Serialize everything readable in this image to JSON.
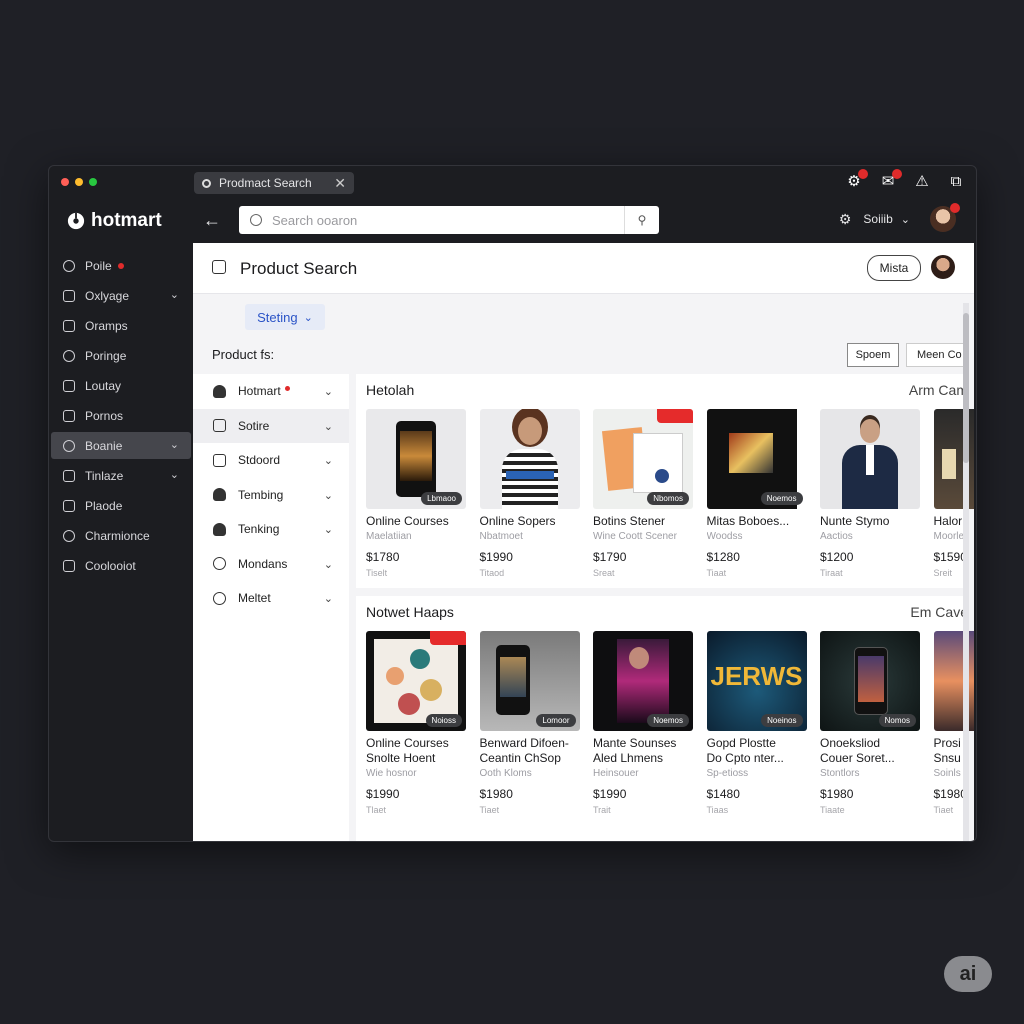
{
  "tab": {
    "title": "Prodmact Search",
    "close": "✕"
  },
  "sidebar": {
    "logo": "hotmart",
    "items": [
      {
        "label": "Poile",
        "has_dot": true,
        "has_chevron": false,
        "active": false
      },
      {
        "label": "Oxlyage",
        "has_dot": false,
        "has_chevron": true,
        "active": false
      },
      {
        "label": "Oramps",
        "has_dot": false,
        "has_chevron": false,
        "active": false
      },
      {
        "label": "Poringe",
        "has_dot": false,
        "has_chevron": false,
        "active": false
      },
      {
        "label": "Loutay",
        "has_dot": false,
        "has_chevron": false,
        "active": false
      },
      {
        "label": "Pornos",
        "has_dot": false,
        "has_chevron": false,
        "active": false
      },
      {
        "label": "Boanie",
        "has_dot": false,
        "has_chevron": true,
        "active": true
      },
      {
        "label": "Tinlaze",
        "has_dot": false,
        "has_chevron": true,
        "active": false
      },
      {
        "label": "Plaode",
        "has_dot": false,
        "has_chevron": false,
        "active": false
      },
      {
        "label": "Charmionce",
        "has_dot": false,
        "has_chevron": false,
        "active": false
      },
      {
        "label": "Coolooiot",
        "has_dot": false,
        "has_chevron": false,
        "active": false
      }
    ]
  },
  "topbar": {
    "search_placeholder": "Search ooaron",
    "account_label": "Soiiib"
  },
  "header": {
    "title": "Product Search",
    "button": "Mista"
  },
  "toolbar": {
    "sort_label": "Steting",
    "sort_chevron": "⌄",
    "filter_label": "Product fs:",
    "btn_primary": "Spoem",
    "btn_secondary": "Meen Co"
  },
  "filters": [
    {
      "label": "Hotmart",
      "dot": true,
      "active": false,
      "icon": "people-icon"
    },
    {
      "label": "Sotire",
      "dot": false,
      "active": true,
      "icon": "square-icon"
    },
    {
      "label": "Stdoord",
      "dot": false,
      "active": false,
      "icon": "frame-icon"
    },
    {
      "label": "Tembing",
      "dot": false,
      "active": false,
      "icon": "cloud-icon"
    },
    {
      "label": "Tenking",
      "dot": false,
      "active": false,
      "icon": "people-icon"
    },
    {
      "label": "Mondans",
      "dot": false,
      "active": false,
      "icon": "bell-icon"
    },
    {
      "label": "Meltet",
      "dot": false,
      "active": false,
      "icon": "location-icon"
    }
  ],
  "sections": [
    {
      "title": "Hetolah",
      "right": "Arm Cam",
      "cards": [
        {
          "title": "Online Courses",
          "sub": "Maelatiian",
          "price": "$1780",
          "meta": "Tiselt",
          "tag": "Lbmaoo",
          "hot": false,
          "art": "phone"
        },
        {
          "title": "Online Sopers",
          "sub": "Nbatmoet",
          "price": "$1990",
          "meta": "Titaod",
          "tag": "",
          "hot": false,
          "art": "woman"
        },
        {
          "title": "Botins Stener",
          "sub": "Wine Coott Scener",
          "price": "$1790",
          "meta": "Sreat",
          "tag": "Nbomos",
          "hot": true,
          "art": "book"
        },
        {
          "title": "Mitas Boboes...",
          "sub": "Woodss",
          "price": "$1280",
          "meta": "Tiaat",
          "tag": "Noemos",
          "hot": false,
          "art": "dark"
        },
        {
          "title": "Nunte Stymo",
          "sub": "Aactios",
          "price": "$1200",
          "meta": "Tiraat",
          "tag": "",
          "hot": false,
          "art": "man"
        },
        {
          "title": "Halor",
          "sub": "Moorle",
          "price": "$1590",
          "meta": "Sreit",
          "tag": "",
          "hot": false,
          "art": "room"
        }
      ]
    },
    {
      "title": "Notwet Haaps",
      "right": "Em Cave",
      "cards": [
        {
          "title": "Online Courses",
          "title2": "Snolte Hoent",
          "sub": "Wie hosnor",
          "price": "$1990",
          "meta": "Tlaet",
          "tag": "Noioss",
          "hot": true,
          "art": "icons"
        },
        {
          "title": "Benward Difoen-",
          "title2": "Ceantin ChSop",
          "sub": "Ooth Kloms",
          "price": "$1980",
          "meta": "Tiaet",
          "tag": "Lomoor",
          "hot": false,
          "art": "phone2"
        },
        {
          "title": "Mante Sounses",
          "title2": "Aled Lhmens",
          "sub": "Heinsouer",
          "price": "$1990",
          "meta": "Trait",
          "tag": "Noemos",
          "hot": false,
          "art": "magazine"
        },
        {
          "title": "Gopd Plostte",
          "title2": "Do Cpto nter...",
          "sub": "Sp-etioss",
          "price": "$1480",
          "meta": "Tiaas",
          "tag": "Noeinos",
          "hot": false,
          "art": "jerws"
        },
        {
          "title": "Onoeksliod",
          "title2": "Couer Soret...",
          "sub": "Stontlors",
          "price": "$1980",
          "meta": "Tiaate",
          "tag": "Nomos",
          "hot": false,
          "art": "phone3"
        },
        {
          "title": "Prosi",
          "title2": "Snsu",
          "sub": "Soinls",
          "price": "$1980",
          "meta": "Tiaet",
          "tag": "",
          "hot": false,
          "art": "sunset"
        }
      ]
    }
  ],
  "art_text": {
    "jerws": "JERWS"
  },
  "brand": {
    "dots": [
      "#ff5f57",
      "#febc2e",
      "#28c840"
    ],
    "accent": "#2b54c7",
    "hot": "#e52b2b"
  },
  "corner_badge": "ai"
}
